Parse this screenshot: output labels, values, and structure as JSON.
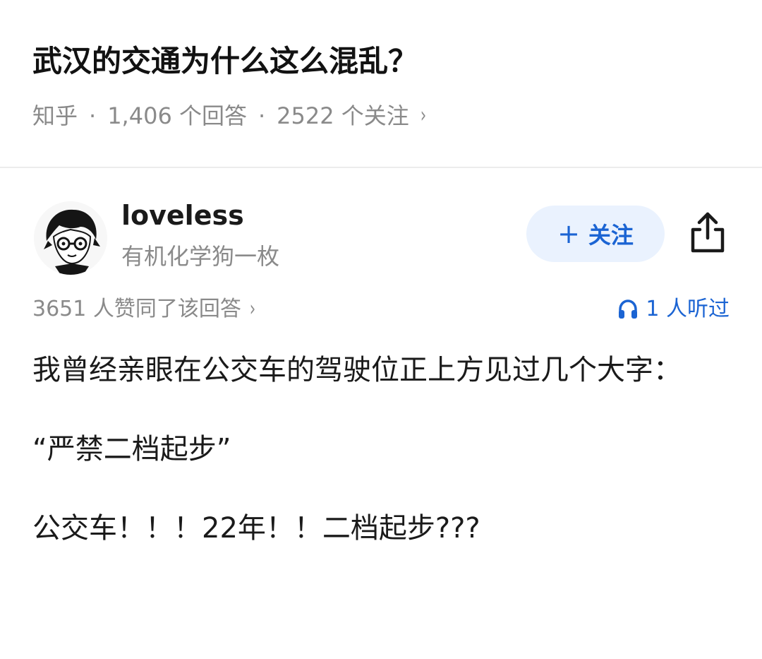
{
  "question": {
    "title": "武汉的交通为什么这么混乱？",
    "source": "知乎",
    "separator": "·",
    "answers": "1,406 个回答",
    "followers": "2522 个关注",
    "chevron": "›"
  },
  "author": {
    "name": "loveless",
    "bio": "有机化学狗一枚",
    "follow_label": "关注",
    "follow_icon": "+",
    "share_icon": "share-icon",
    "avatar_icon": "avatar"
  },
  "stats": {
    "agree": "3651 人赞同了该回答",
    "agree_chevron": "›",
    "listen": "1 人听过",
    "listen_icon": "headphones-icon"
  },
  "content": {
    "paragraphs": [
      "我曾经亲眼在公交车的驾驶位正上方见过几个大字：",
      "“严禁二档起步”",
      "公交车！！！22年！！二档起步???"
    ]
  },
  "colors": {
    "accent": "#1b64d3",
    "muted": "#8a8a8a",
    "follow_bg": "#eaf2fe"
  }
}
